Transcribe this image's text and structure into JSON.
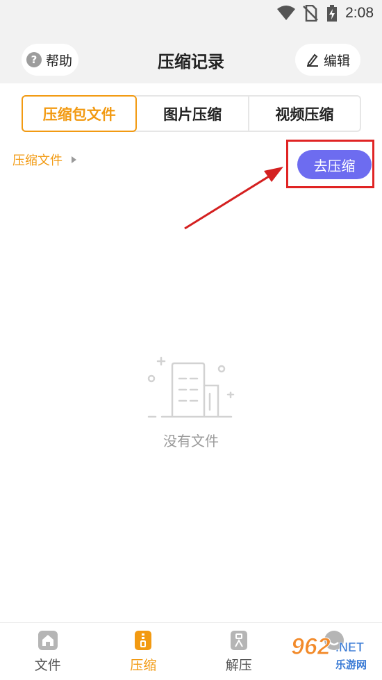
{
  "status_bar": {
    "time": "2:08",
    "icons": [
      "wifi-icon",
      "no-sim-icon",
      "battery-charging-icon"
    ]
  },
  "header": {
    "title": "压缩记录",
    "help_label": "帮助",
    "help_icon_glyph": "?",
    "edit_label": "编辑"
  },
  "tabs": [
    {
      "label": "压缩包文件",
      "active": true
    },
    {
      "label": "图片压缩",
      "active": false
    },
    {
      "label": "视频压缩",
      "active": false
    }
  ],
  "breadcrumb": {
    "label": "压缩文件"
  },
  "go_compress_label": "去压缩",
  "empty_state": {
    "text": "没有文件"
  },
  "bottom_nav": [
    {
      "label": "文件",
      "icon": "home-icon",
      "active": false
    },
    {
      "label": "压缩",
      "icon": "zip-icon",
      "active": true
    },
    {
      "label": "解压",
      "icon": "unzip-icon",
      "active": false
    },
    {
      "label": "",
      "icon": "profile-icon",
      "active": false
    }
  ],
  "colors": {
    "accent": "#f29a12",
    "button": "#6d6cf0",
    "highlight": "#e02424"
  }
}
